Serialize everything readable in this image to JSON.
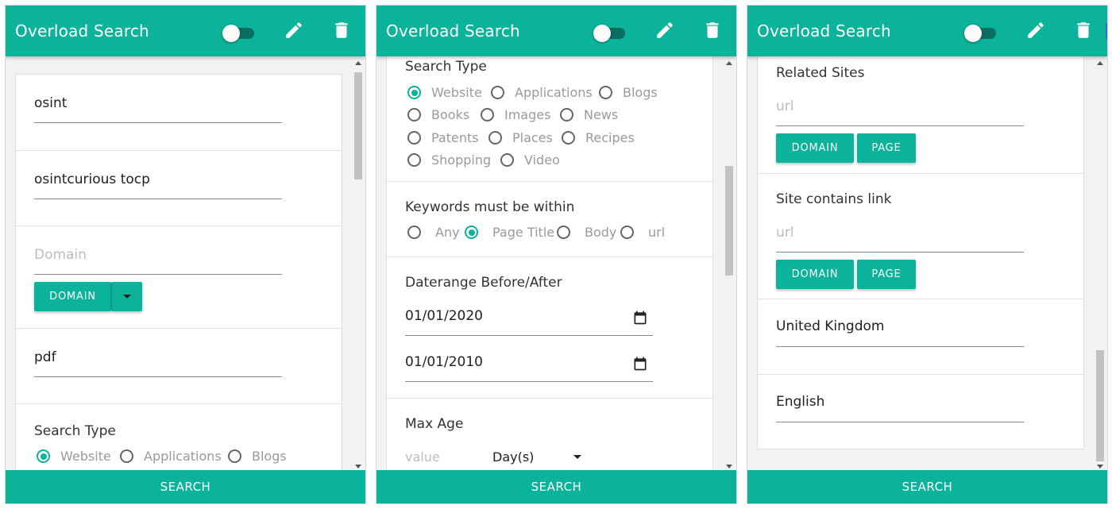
{
  "colors": {
    "accent": "#0bb39b",
    "toggle_track": "#0a6e60"
  },
  "icons": {
    "edit": "pencil-icon",
    "delete": "trash-icon",
    "calendar": "calendar-icon",
    "toggle": "toggle-switch"
  },
  "header": {
    "title": "Overload Search"
  },
  "search_label": "SEARCH",
  "panel1": {
    "fields": [
      {
        "value": "osint"
      },
      {
        "value": "osintcurious tocp"
      },
      {
        "placeholder": "Domain",
        "button": "DOMAIN"
      },
      {
        "value": "pdf"
      }
    ],
    "search_type": {
      "title": "Search Type",
      "options": [
        "Website",
        "Applications",
        "Blogs"
      ],
      "selected": "Website"
    }
  },
  "panel2": {
    "search_type": {
      "title": "Search Type",
      "options": [
        "Website",
        "Applications",
        "Blogs",
        "Books",
        "Images",
        "News",
        "Patents",
        "Places",
        "Recipes",
        "Shopping",
        "Video"
      ],
      "selected": "Website"
    },
    "keywords": {
      "title": "Keywords must be within",
      "options": [
        "Any",
        "Page Title",
        "Body",
        "url"
      ],
      "selected": "Page Title"
    },
    "daterange": {
      "title": "Daterange Before/After",
      "before": "01/01/2020",
      "after": "01/01/2010"
    },
    "max_age": {
      "title": "Max Age",
      "placeholder": "value",
      "unit": "Day(s)"
    }
  },
  "panel3": {
    "related_sites": {
      "title": "Related Sites",
      "placeholder": "url",
      "btn_domain": "DOMAIN",
      "btn_page": "PAGE"
    },
    "contains_link": {
      "title": "Site contains link",
      "placeholder": "url",
      "btn_domain": "DOMAIN",
      "btn_page": "PAGE"
    },
    "country": "United Kingdom",
    "language": "English"
  }
}
